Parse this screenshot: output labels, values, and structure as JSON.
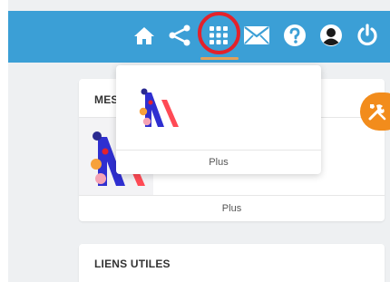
{
  "header": {
    "icons": [
      "home-icon",
      "share-icon",
      "apps-grid-icon",
      "mail-icon",
      "help-icon",
      "user-icon",
      "power-icon"
    ]
  },
  "mes_apps_card": {
    "title": "MES",
    "footer_label": "Plus"
  },
  "apps_dropdown": {
    "footer_label": "Plus"
  },
  "liens_card": {
    "title": "LIENS UTILES"
  },
  "fab": {
    "icon": "tools-icon"
  },
  "colors": {
    "header_bg": "#3b9fd6",
    "highlight": "#e3222b",
    "fab": "#f28c1c",
    "logo_blue": "#2f2fd0",
    "logo_red": "#ff4a55",
    "logo_orange": "#f7a13b",
    "logo_pink": "#f5a3b5"
  }
}
